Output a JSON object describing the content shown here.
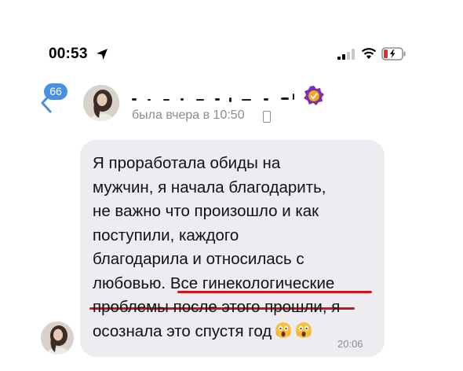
{
  "status_bar": {
    "time": "00:53",
    "icons": [
      "location-arrow-icon",
      "signal-icon",
      "wifi-icon",
      "battery-icon"
    ]
  },
  "header": {
    "unread_count": "66",
    "last_seen": "была вчера в 10:50",
    "icons": [
      "back-chevron-icon",
      "verified-badge-icon",
      "phone-icon"
    ]
  },
  "message": {
    "lines": [
      "Я проработала обиды на",
      "мужчин, я начала благодарить,",
      "не важно что произошло и как",
      "поступили, каждого",
      "благодарила и относилась с",
      "любовью. Все гинекологические",
      "проблемы после этого прошли, я",
      "осознала это спустя год"
    ],
    "time": "20:06",
    "emoji": [
      "screaming-face-emoji",
      "screaming-face-emoji"
    ]
  },
  "colors": {
    "accent": "#4a90e2",
    "bubble": "#ececf1",
    "highlight_underline": "#d0121b",
    "secondary_text": "#8c8c91"
  }
}
